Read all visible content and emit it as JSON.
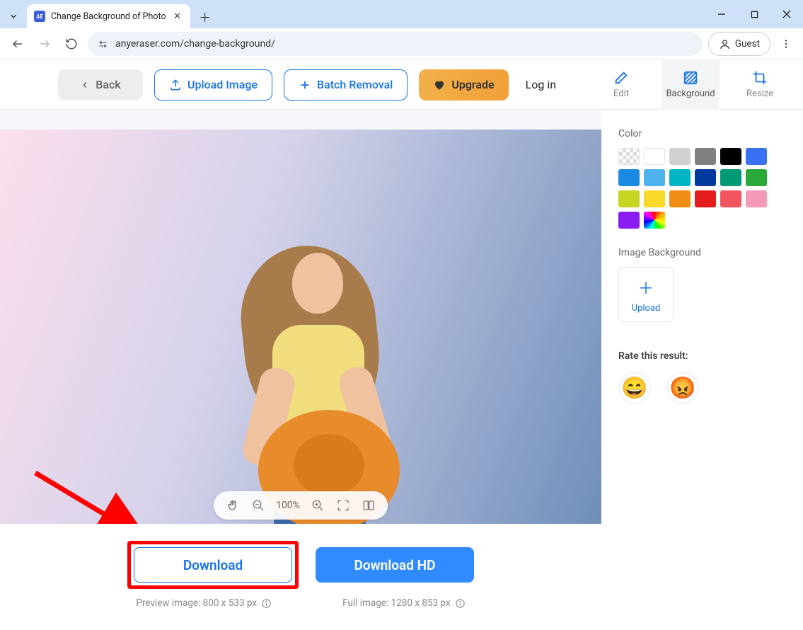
{
  "browser": {
    "tab_title": "Change Background of Photo",
    "url": "anyeraser.com/change-background/",
    "guest_label": "Guest"
  },
  "toolbar": {
    "back_label": "Back",
    "upload_label": "Upload Image",
    "batch_label": "Batch Removal",
    "upgrade_label": "Upgrade",
    "login_label": "Log in",
    "tools": {
      "edit": "Edit",
      "background": "Background",
      "resize": "Resize"
    }
  },
  "canvas": {
    "zoom_percent": "100%"
  },
  "download": {
    "download_label": "Download",
    "download_hd_label": "Download HD",
    "preview_meta": "Preview image: 800 x 533 px",
    "full_meta": "Full image: 1280 x 853 px"
  },
  "sidebar": {
    "color_title": "Color",
    "colors": [
      "transparent",
      "#ffffff",
      "#d1d1d1",
      "#808080",
      "#000000",
      "#3a70f2",
      "#1a8ae3",
      "#4eb3ec",
      "#00b6c4",
      "#003a9e",
      "#009a77",
      "#2aa93b",
      "#c7d422",
      "#f9d92a",
      "#f28d13",
      "#e51c1c",
      "#f2555f",
      "#f59ab6",
      "#8a1cf2",
      "rainbow"
    ],
    "image_bg_title": "Image Background",
    "upload_label": "Upload",
    "rate_title": "Rate this result:"
  }
}
